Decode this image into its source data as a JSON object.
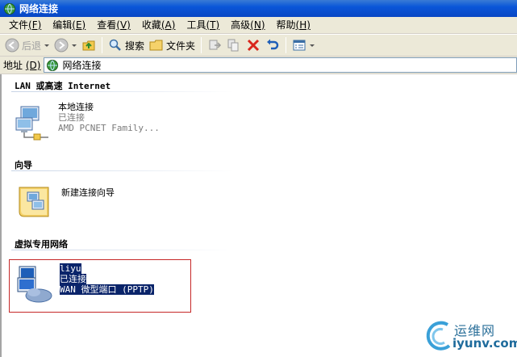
{
  "window": {
    "title": "网络连接"
  },
  "menu": [
    {
      "label": "文件",
      "key": "(F)"
    },
    {
      "label": "编辑",
      "key": "(E)"
    },
    {
      "label": "查看",
      "key": "(V)"
    },
    {
      "label": "收藏",
      "key": "(A)"
    },
    {
      "label": "工具",
      "key": "(T)"
    },
    {
      "label": "高级",
      "key": "(N)"
    },
    {
      "label": "帮助",
      "key": "(H)"
    }
  ],
  "toolbar": {
    "back_label": "后退",
    "search_label": "搜索",
    "folders_label": "文件夹"
  },
  "address": {
    "label": "地址",
    "key": "(D)",
    "value": "网络连接"
  },
  "groups": [
    {
      "header": "LAN 或高速 Internet",
      "items": [
        {
          "name": "本地连接",
          "status": "已连接",
          "device": "AMD PCNET Family..."
        }
      ]
    },
    {
      "header": "向导",
      "items": [
        {
          "name": "新建连接向导"
        }
      ]
    },
    {
      "header": "虚拟专用网络",
      "items": [
        {
          "name": "liyu",
          "status": "已连接",
          "device": "WAN 微型端口 (PPTP)"
        }
      ]
    }
  ],
  "watermark": {
    "cn": "运维网",
    "en": "iyunv.com"
  },
  "colors": {
    "title_bar": "#0a56d8",
    "chrome": "#ece9d8",
    "selection": "#0a246a",
    "highlight_box": "#c62828"
  }
}
